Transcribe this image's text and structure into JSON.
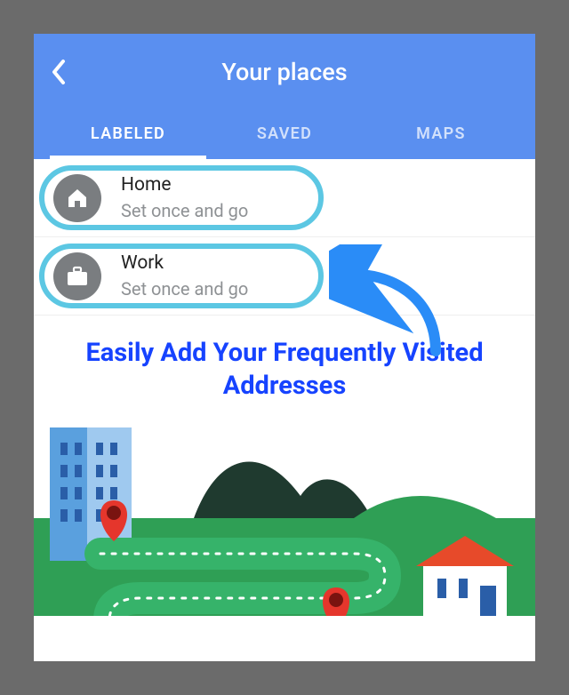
{
  "header": {
    "title": "Your places"
  },
  "tabs": {
    "labeled": "LABELED",
    "saved": "SAVED",
    "maps": "MAPS",
    "active": "labeled"
  },
  "places": [
    {
      "icon": "home-icon",
      "title": "Home",
      "subtitle": "Set once and go"
    },
    {
      "icon": "briefcase-icon",
      "title": "Work",
      "subtitle": "Set once and go"
    }
  ],
  "promo_text": "Easily Add Your Frequently Visited Addresses",
  "colors": {
    "header_bg": "#5a8ff0",
    "highlight_ring": "#5cc7e3",
    "promo_text": "#1643ff",
    "arrow": "#2a8cf7"
  }
}
